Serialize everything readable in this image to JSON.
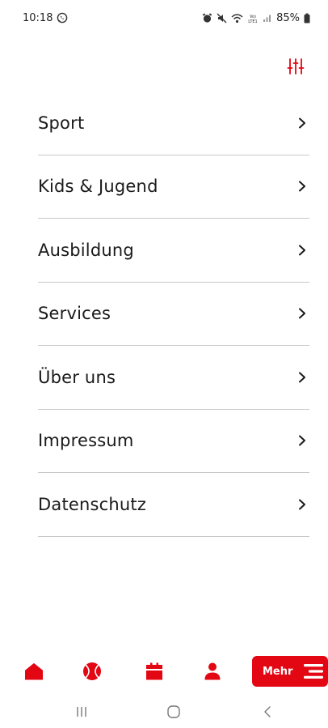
{
  "status_bar": {
    "time": "10:18",
    "battery": "85%",
    "icons": [
      "whatsapp-icon",
      "alarm-icon",
      "mute-icon",
      "wifi-icon",
      "volte-icon",
      "signal-icon",
      "battery-icon"
    ]
  },
  "header": {
    "settings_icon": "sliders-icon"
  },
  "menu": {
    "items": [
      {
        "label": "Sport"
      },
      {
        "label": "Kids & Jugend"
      },
      {
        "label": "Ausbildung"
      },
      {
        "label": "Services"
      },
      {
        "label": "Über uns"
      },
      {
        "label": "Impressum"
      },
      {
        "label": "Datenschutz"
      }
    ]
  },
  "bottom_nav": {
    "items": [
      "home-icon",
      "ball-icon",
      "calendar-icon",
      "profile-icon"
    ],
    "more_label": "Mehr",
    "accent": "#e30613"
  },
  "system_nav": [
    "recent-apps-button",
    "home-button",
    "back-button"
  ]
}
